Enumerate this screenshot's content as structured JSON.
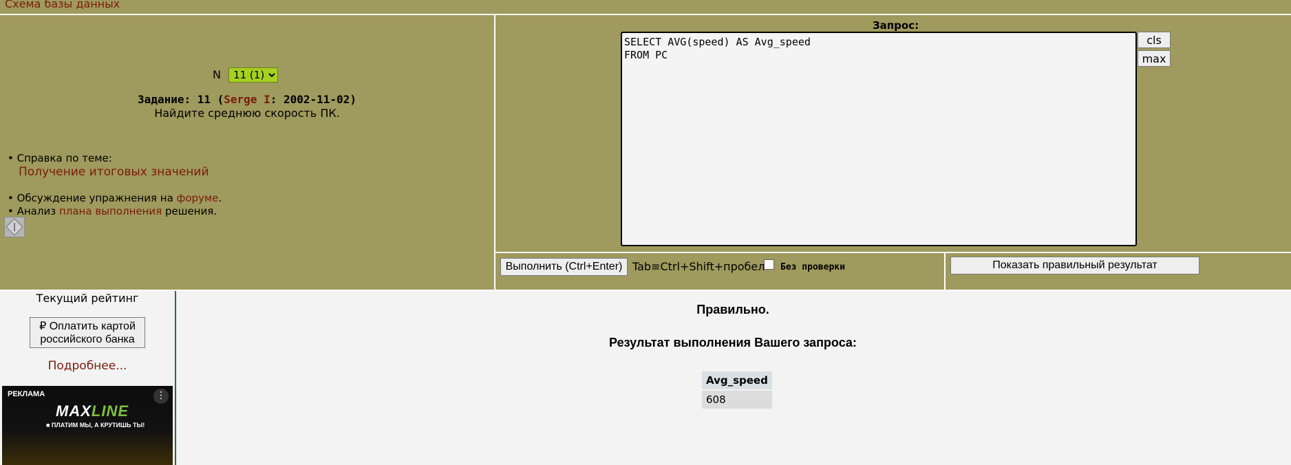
{
  "top": {
    "schema_link": "Схема базы данных"
  },
  "task": {
    "selector_label": "N",
    "selector_value": "11 (1)",
    "title_prefix": "Задание: 11 (",
    "author": "Serge I",
    "title_suffix": ": 2002-11-02)",
    "description": "Найдите среднюю скорость ПК.",
    "help_label": "• Справка по теме:",
    "help_link": "Получение итоговых значений",
    "forum_prefix": "• Обсуждение упражнения на ",
    "forum_link": "форуме",
    "forum_suffix": ".",
    "plan_prefix": "• Анализ ",
    "plan_link": "плана выполнения",
    "plan_suffix": " решения."
  },
  "query": {
    "label": "Запрос:",
    "text": "SELECT AVG(speed) AS Avg_speed\nFROM PC",
    "cls_button": "cls",
    "max_button": "max",
    "execute_button": "Выполнить (Ctrl+Enter)",
    "tab_hint": "Tab≡Ctrl+Shift+пробел",
    "nocheck_label": "Без проверки",
    "show_result_button": "Показать правильный результат"
  },
  "rating": {
    "title": "Текущий рейтинг",
    "pay_button_line1": "₽ Оплатить картой",
    "pay_button_line2": "российского банка",
    "more_link": "Подробнее..."
  },
  "ad": {
    "label": "РЕКЛАМА",
    "logo_max": "MAX",
    "logo_line": "LINE",
    "tagline": "■ ПЛАТИМ МЫ, А КРУТИШЬ ТЫ!"
  },
  "result": {
    "status": "Правильно.",
    "heading": "Результат выполнения Вашего запроса:",
    "columns": [
      "Avg_speed"
    ],
    "rows": [
      [
        "608"
      ]
    ]
  }
}
